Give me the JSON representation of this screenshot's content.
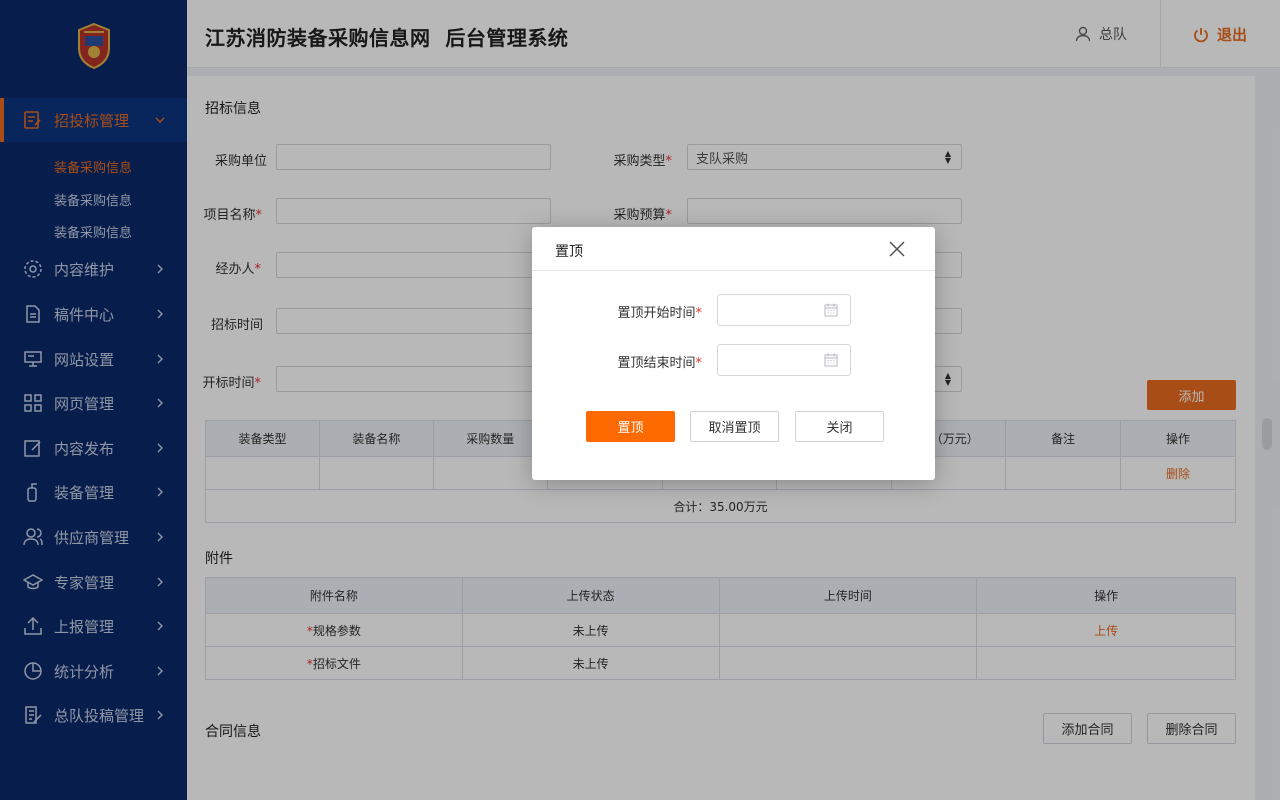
{
  "sidebar": {
    "items": [
      {
        "label": "招投标管理",
        "icon": "document-edit-icon",
        "active": true
      },
      {
        "label": "内容维护",
        "icon": "gear-icon"
      },
      {
        "label": "稿件中心",
        "icon": "file-icon"
      },
      {
        "label": "网站设置",
        "icon": "monitor-icon"
      },
      {
        "label": "网页管理",
        "icon": "grid-icon"
      },
      {
        "label": "内容发布",
        "icon": "edit-icon"
      },
      {
        "label": "装备管理",
        "icon": "extinguisher-icon"
      },
      {
        "label": "供应商管理",
        "icon": "users-icon"
      },
      {
        "label": "专家管理",
        "icon": "graduation-cap-icon"
      },
      {
        "label": "上报管理",
        "icon": "upload-icon"
      },
      {
        "label": "统计分析",
        "icon": "pie-chart-icon"
      },
      {
        "label": "总队投稿管理",
        "icon": "edit-list-icon"
      }
    ],
    "sub_items": [
      {
        "label": "装备采购信息",
        "active": true
      },
      {
        "label": "装备采购信息"
      },
      {
        "label": "装备采购信息"
      }
    ]
  },
  "header": {
    "title": "江苏消防装备采购信息网  后台管理系统",
    "user": "总队",
    "logout": "退出"
  },
  "form": {
    "section_title": "招标信息",
    "purchase_unit_label": "采购单位",
    "purchase_type_label": "采购类型",
    "purchase_type_value": "支队采购",
    "project_name_label": "项目名称",
    "budget_label": "采购预算",
    "handler_label": "经办人",
    "bid_time_label": "招标时间",
    "open_time_label": "开标时间",
    "add_button": "添加"
  },
  "equipment_table": {
    "headers": [
      "装备类型",
      "装备名称",
      "采购数量",
      "",
      "",
      "",
      "计（万元）",
      "备注",
      "操作"
    ],
    "row_action": "删除",
    "total": "合计：35.00万元"
  },
  "attachments": {
    "section_title": "附件",
    "headers": [
      "附件名称",
      "上传状态",
      "上传时间",
      "操作"
    ],
    "rows": [
      {
        "name": "规格参数",
        "status": "未上传",
        "time": "",
        "action": "上传"
      },
      {
        "name": "招标文件",
        "status": "未上传",
        "time": "",
        "action": ""
      }
    ]
  },
  "contract": {
    "section_title": "合同信息",
    "add_button": "添加合同",
    "delete_button": "删除合同"
  },
  "dialog": {
    "title": "置顶",
    "start_label": "置顶开始时间",
    "end_label": "置顶结束时间",
    "confirm_button": "置顶",
    "cancel_top_button": "取消置顶",
    "close_button": "关闭"
  },
  "colors": {
    "sidebar_bg": "#0a2a6b",
    "accent": "#e86b1e",
    "required": "#e5322d"
  }
}
